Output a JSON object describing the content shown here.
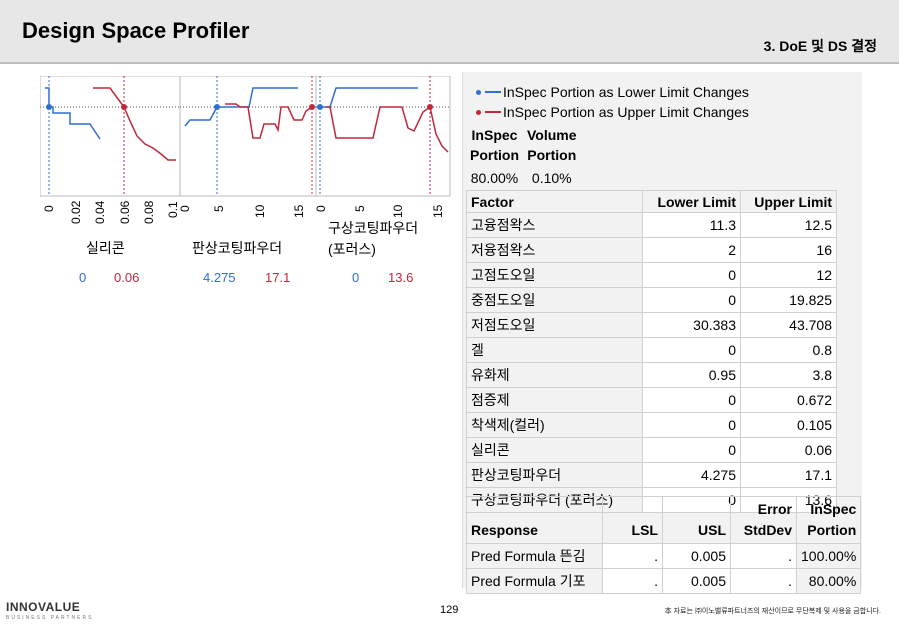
{
  "header": {
    "title": "Design Space Profiler",
    "section": "3. DoE 및 DS 결정"
  },
  "profiler": {
    "factors": [
      {
        "name": "실리콘",
        "ticks": [
          "0",
          "0.02",
          "0.04",
          "0.06",
          "0.08",
          "0.1"
        ],
        "lower": "0",
        "upper": "0.06"
      },
      {
        "name": "판상코팅파우더",
        "ticks": [
          "0",
          "5",
          "10",
          "15"
        ],
        "lower": "4.275",
        "upper": "17.1"
      },
      {
        "name_line1": "구상코팅파우더",
        "name_line2": "(포러스)",
        "ticks": [
          "0",
          "5",
          "10",
          "15"
        ],
        "lower": "0",
        "upper": "13.6"
      }
    ],
    "colors": {
      "lower": "#2f6fd1",
      "upper": "#c0283c"
    }
  },
  "legend": {
    "lower": "InSpec Portion as Lower Limit Changes",
    "upper": "InSpec Portion as Upper Limit Changes"
  },
  "inspec_table": {
    "headers": [
      [
        "InSpec",
        "Portion"
      ],
      [
        "Volume",
        "Portion"
      ]
    ],
    "values": [
      "80.00%",
      "0.10%"
    ]
  },
  "factor_table": {
    "headers": [
      "Factor",
      "Lower Limit",
      "Upper Limit"
    ],
    "rows": [
      [
        "고융점왁스",
        "11.3",
        "12.5"
      ],
      [
        "저융점왁스",
        "2",
        "16"
      ],
      [
        "고점도오일",
        "0",
        "12"
      ],
      [
        "중점도오일",
        "0",
        "19.825"
      ],
      [
        "저점도오일",
        "30.383",
        "43.708"
      ],
      [
        "겔",
        "0",
        "0.8"
      ],
      [
        "유화제",
        "0.95",
        "3.8"
      ],
      [
        "점증제",
        "0",
        "0.672"
      ],
      [
        "착색제(컬러)",
        "0",
        "0.105"
      ],
      [
        "실리콘",
        "0",
        "0.06"
      ],
      [
        "판상코팅파우더",
        "4.275",
        "17.1"
      ],
      [
        "구상코팅파우더 (포러스)",
        "0",
        "13.6"
      ]
    ]
  },
  "response_table": {
    "headers": [
      "Response",
      "LSL",
      "USL",
      "Error StdDev",
      "InSpec Portion"
    ],
    "header_lines": {
      "error": [
        "Error",
        "StdDev"
      ],
      "inspec": [
        "InSpec",
        "Portion"
      ]
    },
    "rows": [
      [
        "Pred Formula 뜬김",
        ".",
        "0.005",
        ".",
        "100.00%"
      ],
      [
        "Pred Formula 기포",
        ".",
        "0.005",
        ".",
        "80.00%"
      ]
    ]
  },
  "footer": {
    "logo": "INNOVALUE",
    "logo_sub": "BUSINESS PARTNERS",
    "page": "129",
    "copyright": "本 자료는 ㈜이노밸류파트너즈의 재산이므로 무단복제 및 사용을 금합니다."
  }
}
